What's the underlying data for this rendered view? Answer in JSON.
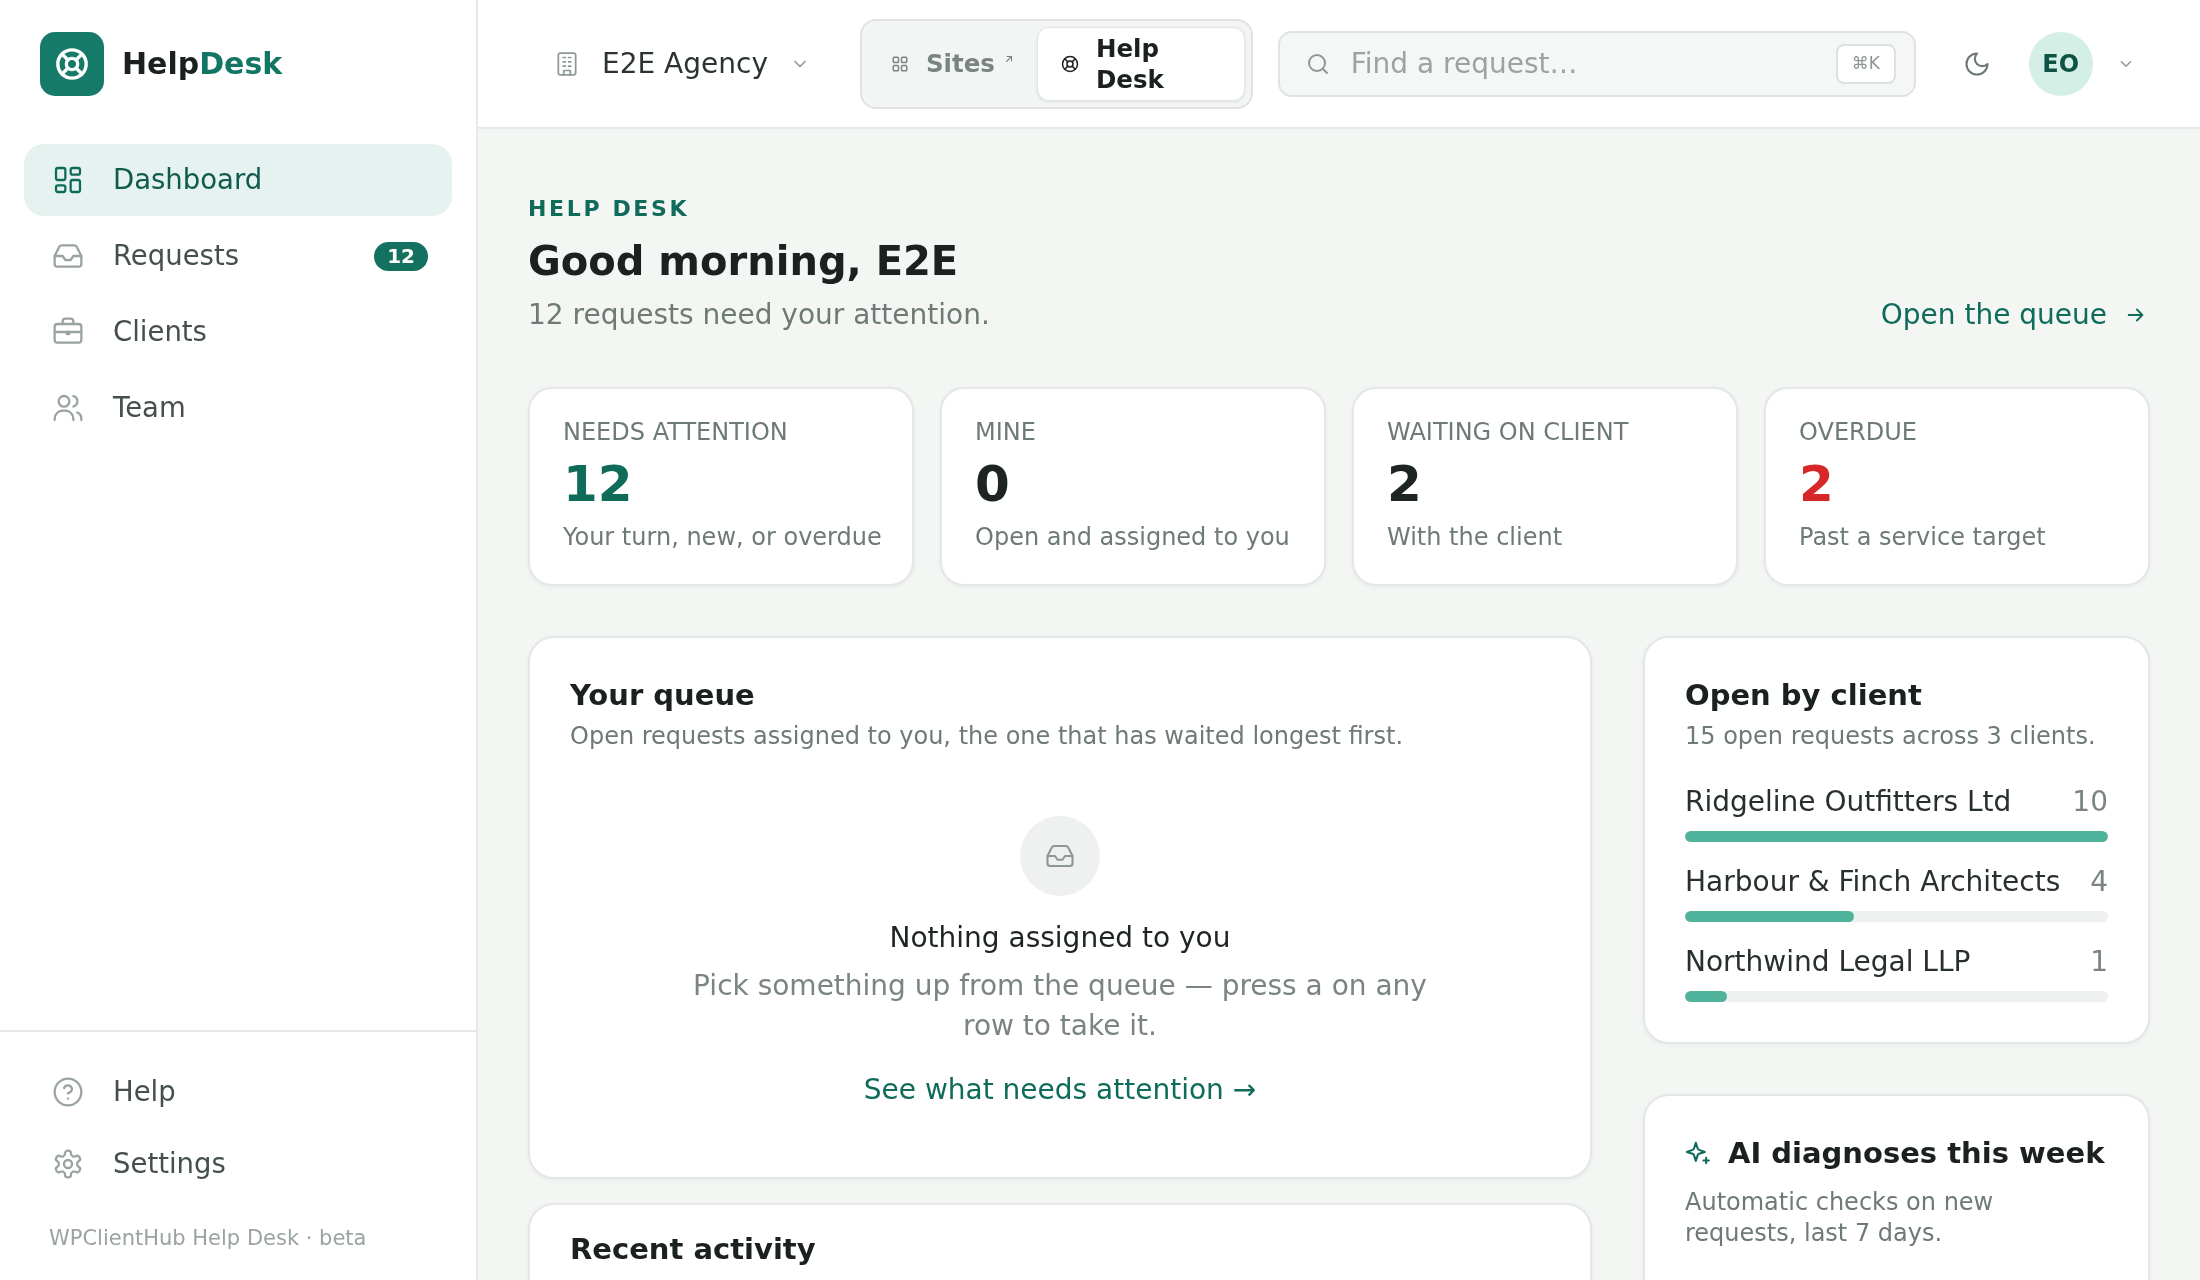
{
  "sidebar": {
    "brand": {
      "name": "Help",
      "accent": "Desk"
    },
    "nav": [
      {
        "label": "Dashboard",
        "selected": true
      },
      {
        "label": "Requests",
        "badge": "12",
        "selected": false
      },
      {
        "label": "Clients",
        "selected": false
      },
      {
        "label": "Team",
        "selected": false
      }
    ],
    "secondary_nav": [
      {
        "label": "Help",
        "selected": false
      },
      {
        "label": "Settings",
        "selected": false
      }
    ],
    "footer": "WPClientHub Help Desk · beta"
  },
  "topbar": {
    "organization": "E2E Agency",
    "switcher": [
      {
        "label": "Sites",
        "external": true,
        "selected": false
      },
      {
        "label": "Help Desk",
        "external": false,
        "selected": true
      }
    ],
    "search": {
      "placeholder": "Find a request…",
      "shortcut": "⌘K"
    },
    "avatar": "EO"
  },
  "header": {
    "eyebrow": "HELP DESK",
    "title": "Good morning, E2E",
    "subtitle": "12 requests need your attention.",
    "action": "Open the queue"
  },
  "stats": [
    {
      "label": "NEEDS ATTENTION",
      "value": "12",
      "note": "Your turn, new, or overdue",
      "color": "#0f6b5a"
    },
    {
      "label": "MINE",
      "value": "0",
      "note": "Open and assigned to you",
      "color": "#1d2421"
    },
    {
      "label": "WAITING ON CLIENT",
      "value": "2",
      "note": "With the client",
      "color": "#1d2421"
    },
    {
      "label": "OVERDUE",
      "value": "2",
      "note": "Past a service target",
      "color": "#d62828"
    }
  ],
  "queue": {
    "title": "Your queue",
    "subtitle": "Open requests assigned to you, the one that has waited longest first.",
    "empty": {
      "title": "Nothing assigned to you",
      "message": "Pick something up from the queue — press a on any row to take it.",
      "link": "See what needs attention →"
    }
  },
  "recent_activity": {
    "title": "Recent activity"
  },
  "clients": {
    "title": "Open by client",
    "subtitle": "15 open requests across 3 clients.",
    "rows": [
      {
        "name": "Ridgeline Outfitters Ltd",
        "count": "10",
        "level": 1
      },
      {
        "name": "Harbour & Finch Architects",
        "count": "4",
        "level": 0.4
      },
      {
        "name": "Northwind Legal LLP",
        "count": "1",
        "level": 0.1
      }
    ]
  },
  "ai_diagnoses": {
    "title": "AI diagnoses this week",
    "subtitle": "Automatic checks on new requests, last 7 days."
  }
}
